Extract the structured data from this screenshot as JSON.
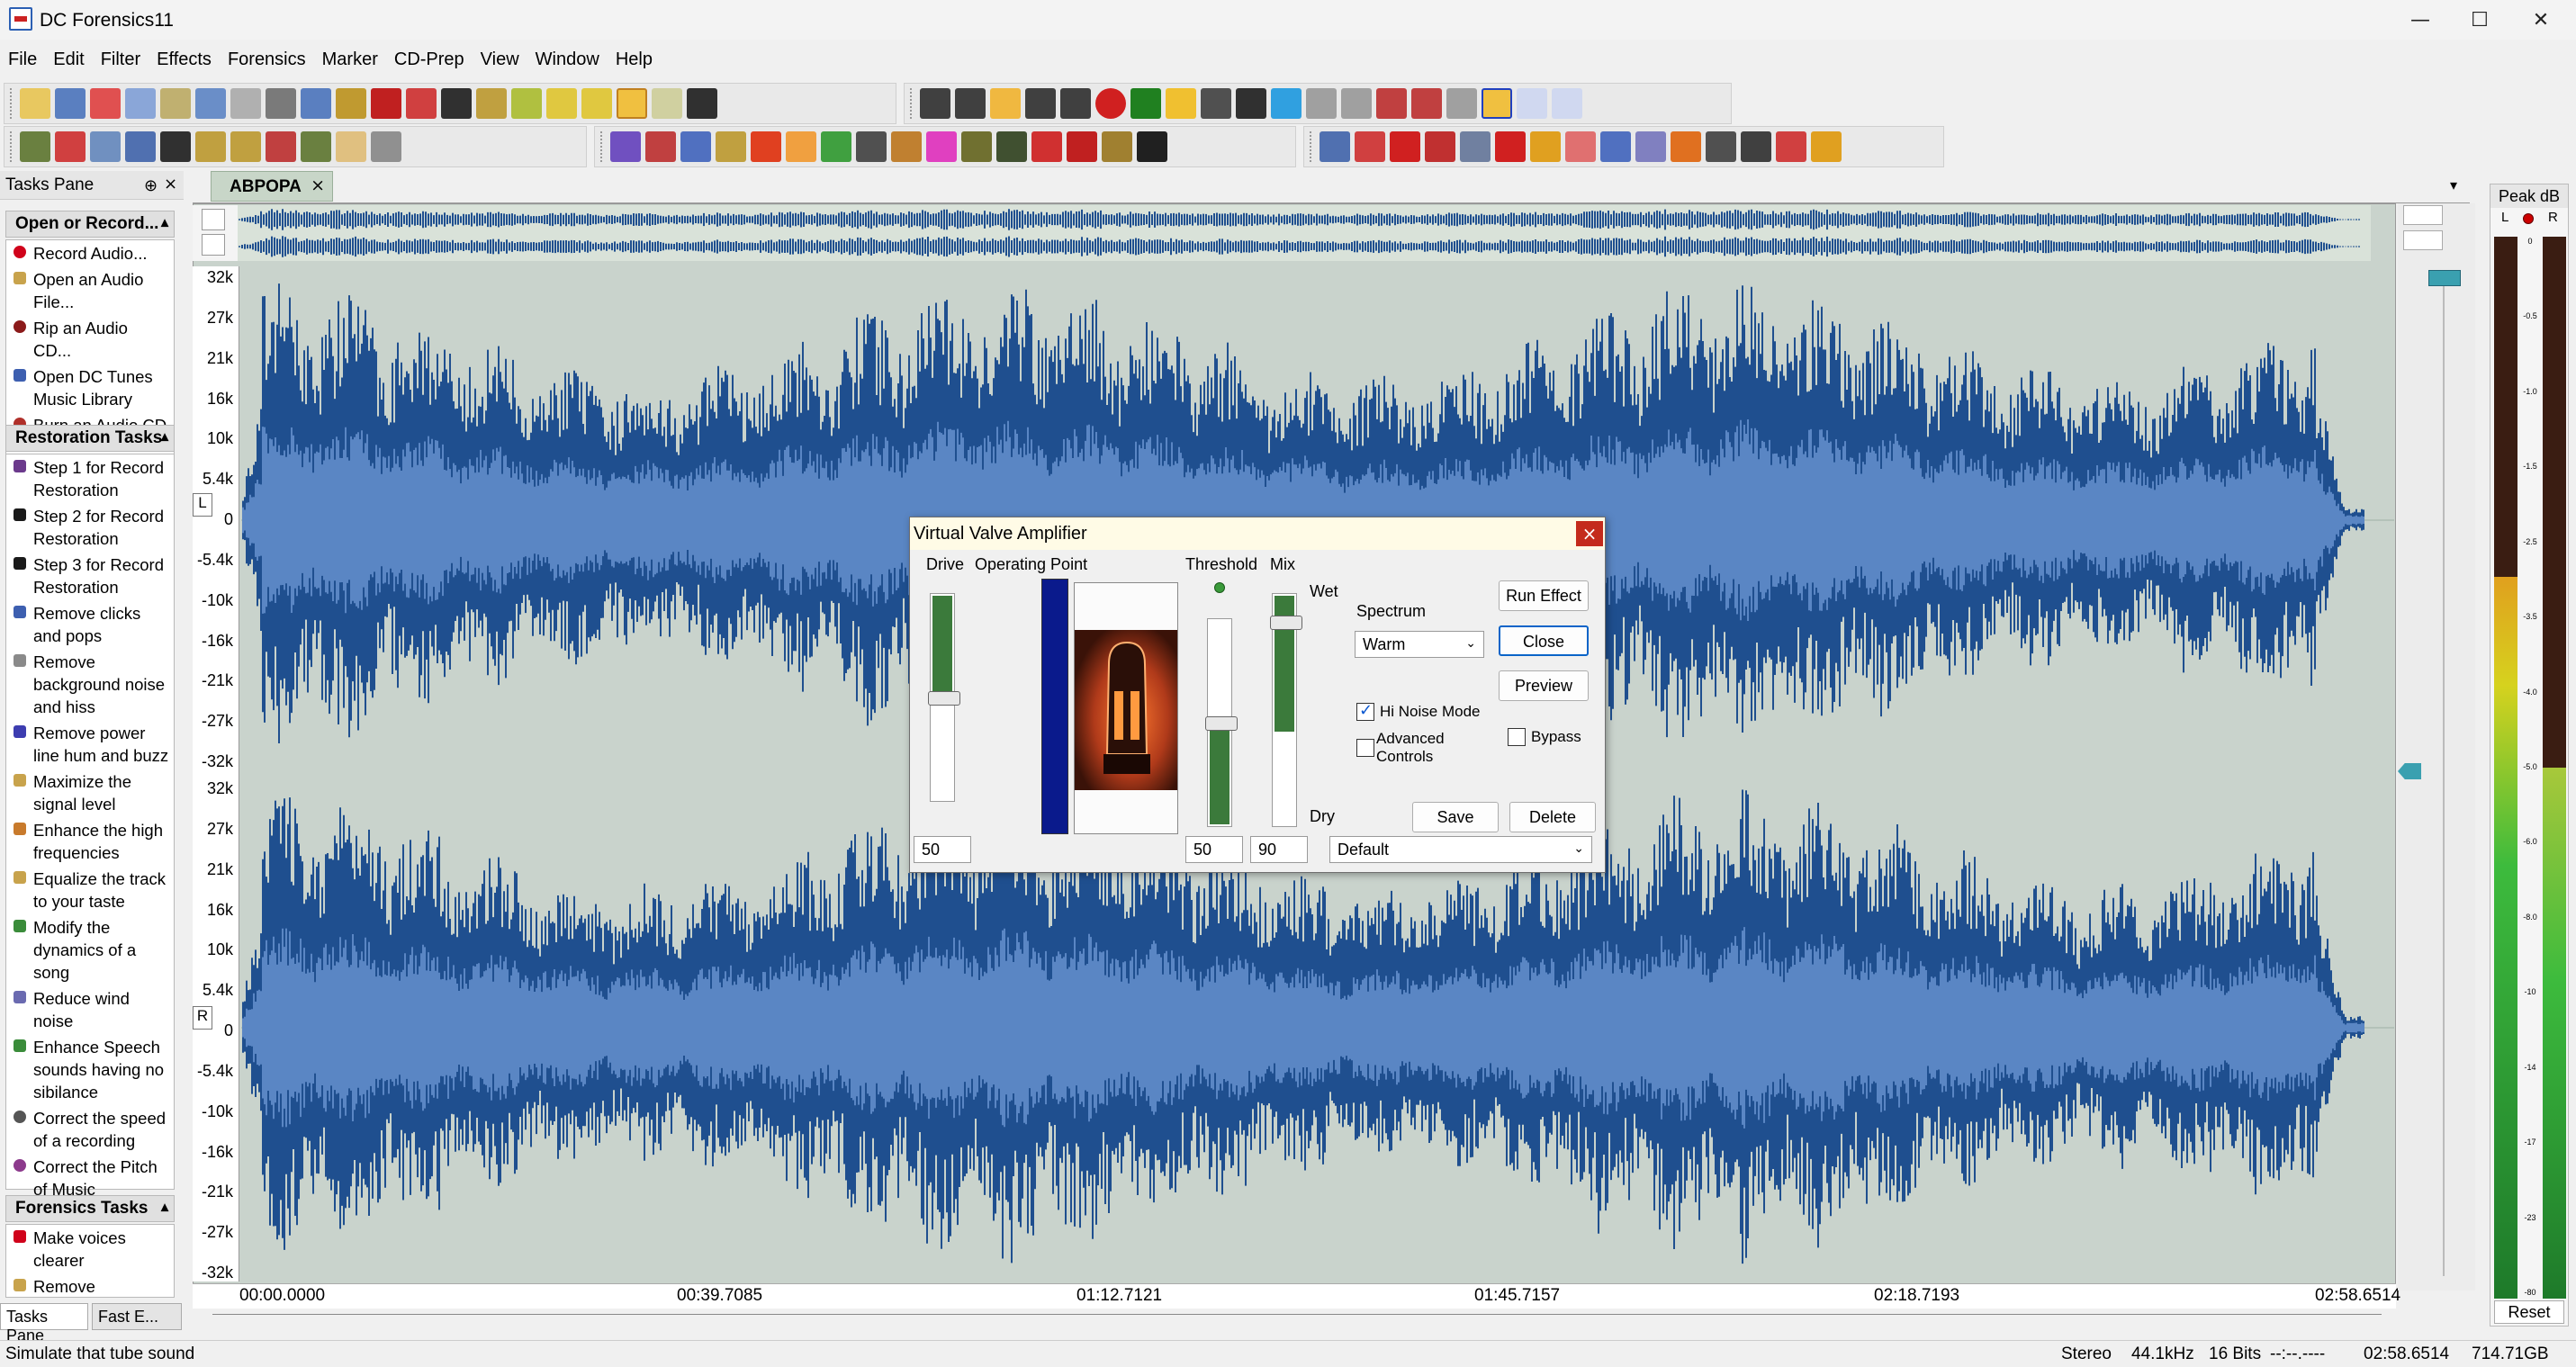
{
  "window": {
    "title": "DC Forensics11",
    "minimize": "—",
    "maximize": "☐",
    "close": "✕"
  },
  "menu": [
    "File",
    "Edit",
    "Filter",
    "Effects",
    "Forensics",
    "Marker",
    "CD-Prep",
    "View",
    "Window",
    "Help"
  ],
  "tasks_pane": {
    "title": "Tasks Pane",
    "sections": [
      {
        "title": "Open or Record...",
        "items": [
          {
            "label": "Record Audio...",
            "color": "#d0021b"
          },
          {
            "label": "Open an Audio File...",
            "color": "#c8a34c"
          },
          {
            "label": "Rip an Audio CD...",
            "color": "#8b1a1a"
          },
          {
            "label": "Open DC Tunes Music Library",
            "color": "#3d5fb0"
          },
          {
            "label": "Burn an Audio CD",
            "color": "#b0302a"
          }
        ]
      },
      {
        "title": "Restoration Tasks",
        "items": [
          {
            "label": "Step 1 for Record Restoration",
            "color": "#6b3a8c"
          },
          {
            "label": "Step 2 for Record Restoration",
            "color": "#1a1a1a"
          },
          {
            "label": "Step 3 for Record Restoration",
            "color": "#1a1a1a"
          },
          {
            "label": "Remove clicks and pops",
            "color": "#3d5fb0"
          },
          {
            "label": "Remove background noise and hiss",
            "color": "#8a8a8a"
          },
          {
            "label": "Remove power line hum and buzz",
            "color": "#3d3db0"
          },
          {
            "label": "Maximize the signal level",
            "color": "#c8a34c"
          },
          {
            "label": "Enhance the high frequencies",
            "color": "#c87a2c"
          },
          {
            "label": "Equalize the track to your taste",
            "color": "#c8a34c"
          },
          {
            "label": "Modify the dynamics of a song",
            "color": "#3a8c3a"
          },
          {
            "label": "Reduce wind noise",
            "color": "#6a6ab0"
          },
          {
            "label": "Enhance Speech sounds having no sibilance",
            "color": "#3a8c3a"
          },
          {
            "label": "Correct the speed of a recording",
            "color": "#555555"
          },
          {
            "label": "Correct the Pitch of Music",
            "color": "#8c3a8c"
          }
        ]
      },
      {
        "title": "Forensics Tasks",
        "items": [
          {
            "label": "Make voices clearer",
            "color": "#d0021b"
          },
          {
            "label": "Remove",
            "color": "#c8a34c"
          }
        ]
      }
    ],
    "footer_tabs": [
      "Tasks Pane",
      "Fast E..."
    ]
  },
  "editor": {
    "tab_label": "ABPOPA",
    "ruler_labels": [
      "32k",
      "27k",
      "21k",
      "16k",
      "10k",
      "5.4k",
      "0",
      "-5.4k",
      "-10k",
      "-16k",
      "-21k",
      "-27k",
      "-32k"
    ],
    "channel_left": "L",
    "channel_right": "R",
    "timeline": [
      "00:00.0000",
      "00:39.7085",
      "01:12.7121",
      "01:45.7157",
      "02:18.7193",
      "02:58.6514"
    ]
  },
  "peak_meter": {
    "title": "Peak dB",
    "left": "L",
    "right": "R",
    "scale": [
      "0",
      "-0.5",
      "-1.0",
      "-1.5",
      "-2.5",
      "-3.5",
      "-4.0",
      "-5.0",
      "-6.0",
      "-8.0",
      "-10",
      "-14",
      "-17",
      "-23",
      "-80"
    ],
    "reset": "Reset",
    "level_left": 0.68,
    "level_right": 0.5
  },
  "dialog": {
    "title": "Virtual Valve Amplifier",
    "close": "×",
    "drive_label": "Drive",
    "operating_point_label": "Operating Point",
    "threshold_label": "Threshold",
    "mix_label": "Mix",
    "wet_label": "Wet",
    "dry_label": "Dry",
    "spectrum_label": "Spectrum",
    "spectrum_value": "Warm",
    "hi_noise_label": "Hi Noise Mode",
    "hi_noise_checked": true,
    "advanced_label": "Advanced Controls",
    "advanced_checked": false,
    "bypass_label": "Bypass",
    "bypass_checked": false,
    "buttons": {
      "run": "Run Effect",
      "close": "Close",
      "preview": "Preview",
      "save": "Save",
      "delete": "Delete"
    },
    "drive_value": "50",
    "threshold_value": "50",
    "mix_value": "90",
    "preset": "Default",
    "drive_level": 0.5,
    "threshold_level": 0.5,
    "mix_level": 0.9
  },
  "status": {
    "message": "Simulate that tube sound",
    "channels": "Stereo",
    "rate": "44.1kHz",
    "bits": "16 Bits",
    "position": "--:--.----",
    "duration": "02:58.6514",
    "disk": "714.71GB"
  },
  "colors": {
    "wave": "#1f4f8f",
    "wave_core": "#5a86c4",
    "editor_bg": "#c9d3cc",
    "fill_green": "#3b7a3b",
    "op_blue": "#0a1a8c"
  }
}
